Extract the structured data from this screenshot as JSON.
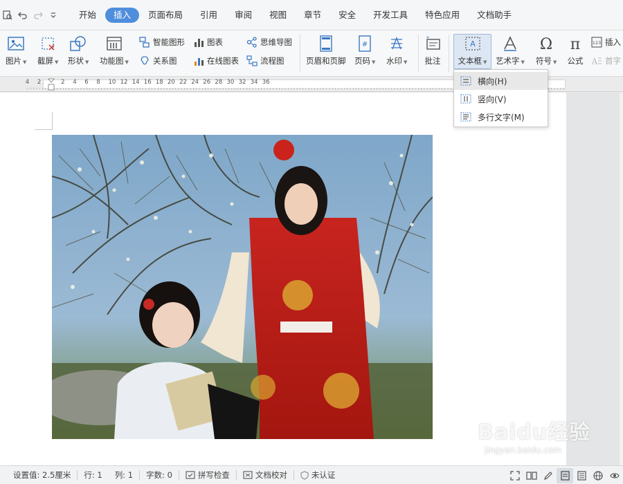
{
  "menu": {
    "tabs": [
      {
        "label": "开始"
      },
      {
        "label": "插入"
      },
      {
        "label": "页面布局"
      },
      {
        "label": "引用"
      },
      {
        "label": "审阅"
      },
      {
        "label": "视图"
      },
      {
        "label": "章节"
      },
      {
        "label": "安全"
      },
      {
        "label": "开发工具"
      },
      {
        "label": "特色应用"
      },
      {
        "label": "文档助手"
      }
    ],
    "active_tab": "插入"
  },
  "ribbon": {
    "picture": "图片",
    "screenshot": "截屏",
    "shape": "形状",
    "function_chart": "功能图",
    "smart_shape": "智能图形",
    "chart": "图表",
    "mindmap": "思维导图",
    "relation": "关系图",
    "online_chart": "在线图表",
    "flowchart": "流程图",
    "header_footer": "页眉和页脚",
    "page_number": "页码",
    "watermark": "水印",
    "comment": "批注",
    "textbox": "文本框",
    "wordart": "艺术字",
    "symbol": "符号",
    "formula": "公式",
    "insert_number": "插入",
    "dropcap": "首字"
  },
  "ruler": {
    "numbers": [
      "4",
      "2",
      "2",
      "4",
      "6",
      "8",
      "10",
      "12",
      "14",
      "16",
      "18",
      "20",
      "22",
      "24",
      "26",
      "28",
      "30",
      "32",
      "34",
      "36"
    ]
  },
  "textbox_menu": {
    "items": [
      {
        "label": "横向(H)"
      },
      {
        "label": "竖向(V)"
      },
      {
        "label": "多行文字(M)"
      }
    ]
  },
  "status": {
    "setting": "设置值: 2.5厘米",
    "row": "行: 1",
    "col": "列: 1",
    "words": "字数: 0",
    "spell": "拼写检查",
    "proof": "文档校对",
    "auth": "未认证"
  },
  "watermark": {
    "brand": "Baidu",
    "brand_cn": "经验",
    "url": "jingyan.baidu.com"
  },
  "colors": {
    "accent": "#4f8edc",
    "ribbon_bg": "#f7f8f9",
    "page": "#ffffff"
  }
}
